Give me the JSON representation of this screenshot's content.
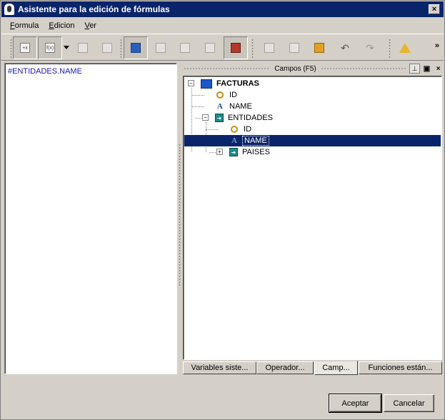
{
  "window": {
    "title": "Asistente para la edición de fórmulas",
    "close_label": "×"
  },
  "menu": {
    "items": [
      "Formula",
      "Edicion",
      "Ver"
    ]
  },
  "toolbar": {
    "buttons": [
      {
        "icon": "insert-formula-icon",
        "pressed": true,
        "glyph": "+x"
      },
      {
        "icon": "function-icon",
        "pressed": true,
        "glyph": "f(x)"
      },
      {
        "icon": "field-icon",
        "pressed": false,
        "glyph": ""
      },
      {
        "icon": "eraser-icon",
        "pressed": false,
        "glyph": ""
      },
      {
        "icon": "fields-panel-icon",
        "pressed": true,
        "glyph": ""
      },
      {
        "icon": "copy-icon",
        "pressed": false,
        "glyph": ""
      },
      {
        "icon": "table-icon",
        "pressed": false,
        "glyph": ""
      },
      {
        "icon": "properties-icon",
        "pressed": false,
        "glyph": ""
      },
      {
        "icon": "record-icon",
        "pressed": true,
        "glyph": ""
      },
      {
        "icon": "cut-icon",
        "pressed": false,
        "glyph": ""
      },
      {
        "icon": "paste-icon",
        "pressed": false,
        "glyph": ""
      },
      {
        "icon": "paste-special-icon",
        "pressed": false,
        "glyph": ""
      },
      {
        "icon": "undo-icon",
        "pressed": false,
        "glyph": ""
      },
      {
        "icon": "redo-icon",
        "pressed": false,
        "glyph": ""
      },
      {
        "icon": "warning-icon",
        "pressed": false,
        "glyph": ""
      }
    ],
    "more_label": "»"
  },
  "editor": {
    "formula": "#ENTIDADES.NAME"
  },
  "fields_panel": {
    "title": "Campos (F5)",
    "pin_label": "⊥",
    "float_label": "▣",
    "close_label": "×"
  },
  "tree": {
    "root": "FACTURAS",
    "nodes": [
      {
        "label": "ID",
        "icon": "key-icon"
      },
      {
        "label": "NAME",
        "icon": "text-field-icon"
      },
      {
        "label": "ENTIDADES",
        "icon": "relation-icon"
      },
      {
        "label": "ID",
        "icon": "key-icon"
      },
      {
        "label": "NAME",
        "icon": "text-field-icon",
        "selected": true
      },
      {
        "label": "PAISES",
        "icon": "relation-icon"
      }
    ]
  },
  "tabs": [
    {
      "label": "Variables siste...",
      "active": false
    },
    {
      "label": "Operador...",
      "active": false
    },
    {
      "label": "Camp...",
      "active": true
    },
    {
      "label": "Funciones están...",
      "active": false
    }
  ],
  "buttons": {
    "accept": "Aceptar",
    "cancel": "Cancelar"
  }
}
